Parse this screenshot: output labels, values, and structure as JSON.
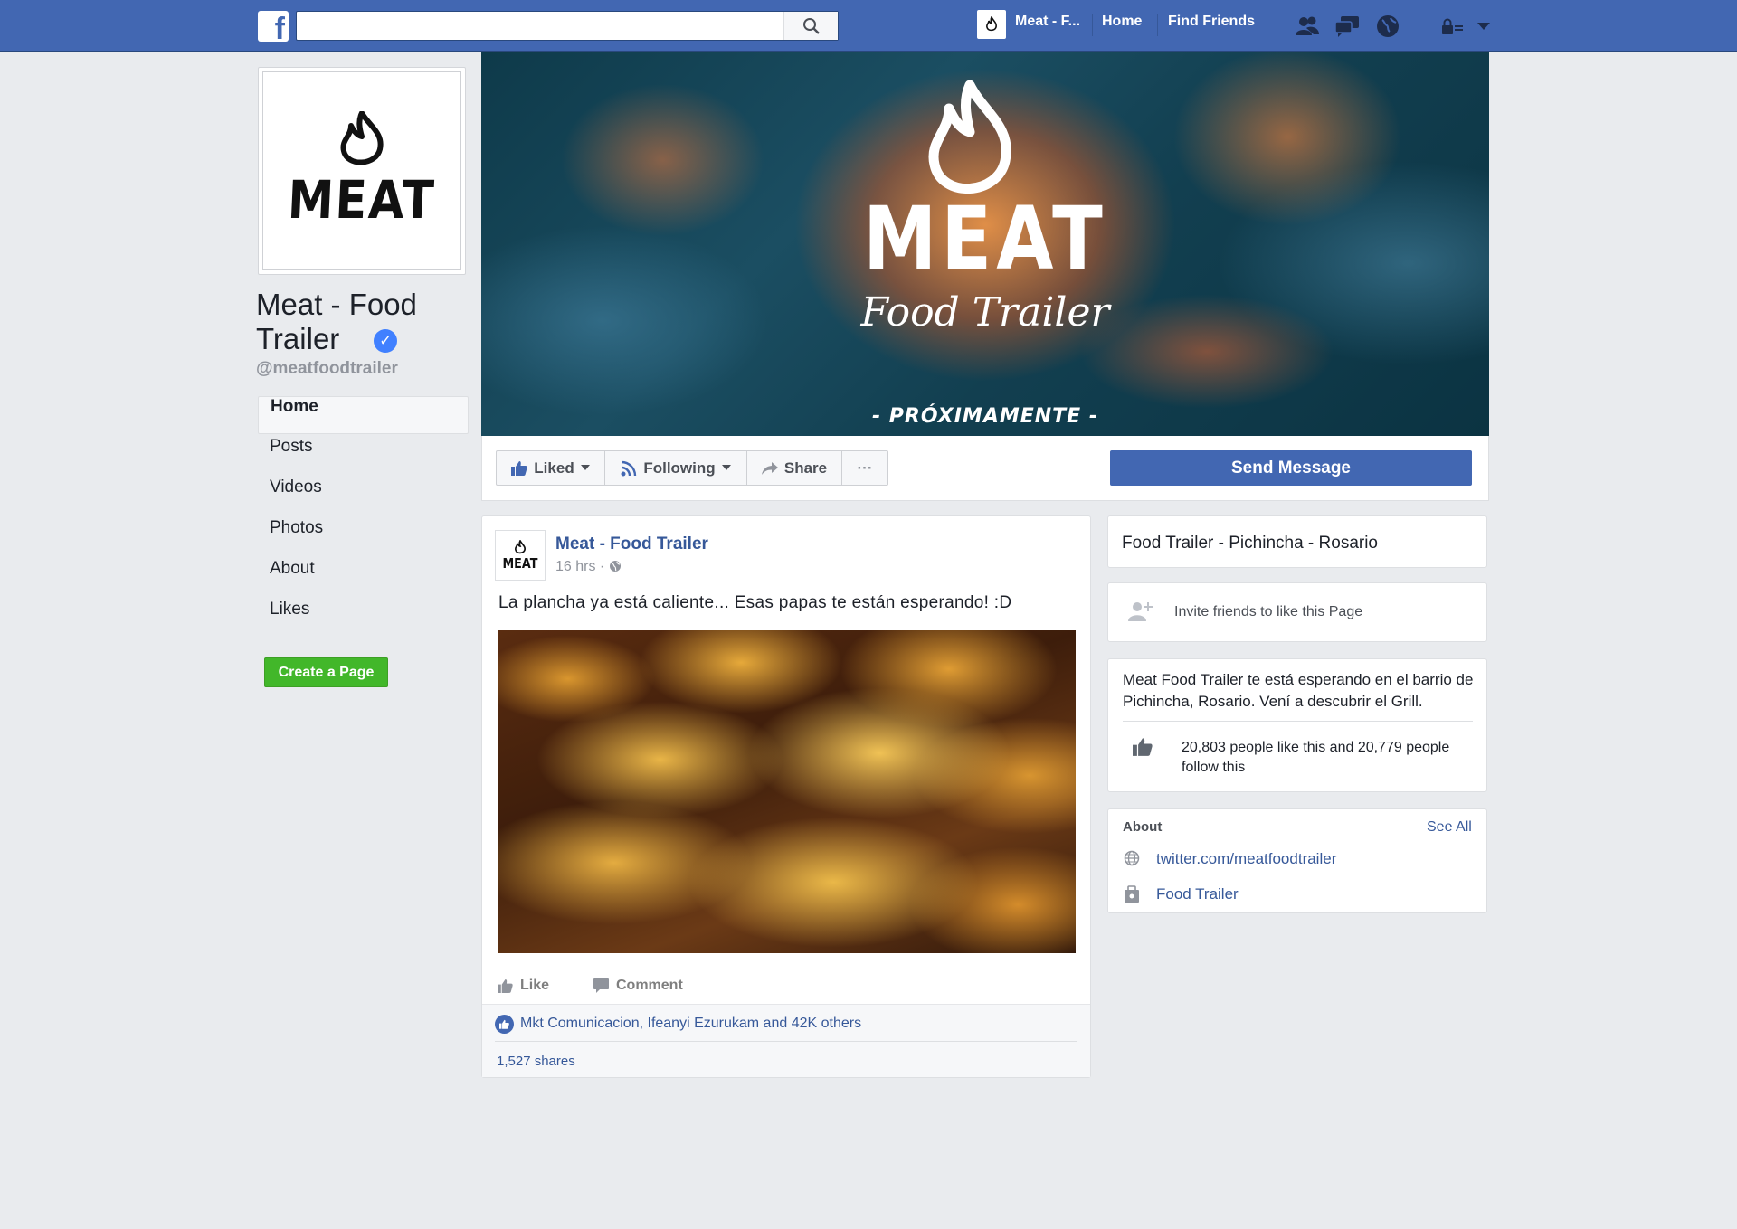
{
  "topbar": {
    "logo": "f",
    "search_placeholder": "",
    "page_shortcut": "Meat - F...",
    "home": "Home",
    "find_friends": "Find Friends"
  },
  "left": {
    "profile_logo_text": "MEAT",
    "page_name": "Meat - Food Trailer",
    "verified_mark": "✓",
    "handle": "@meatfoodtrailer",
    "nav": [
      "Home",
      "Posts",
      "Videos",
      "Photos",
      "About",
      "Likes"
    ],
    "create_page": "Create a Page"
  },
  "cover": {
    "title": "MEAT",
    "subtitle": "Food Trailer",
    "coming_soon": "- PRÓXIMAMENTE -"
  },
  "actions": {
    "liked": "Liked",
    "following": "Following",
    "share": "Share",
    "more": "···",
    "send_message": "Send Message"
  },
  "post": {
    "author": "Meat - Food Trailer",
    "time": "16 hrs · ",
    "text": "La plancha ya está caliente... Esas papas te están esperando!  :D",
    "like": "Like",
    "comment": "Comment",
    "likes_summary": "Mkt Comunicacion, Ifeanyi Ezurukam and 42K others",
    "shares": "1,527 shares"
  },
  "sidebar": {
    "category": "Food Trailer - Pichincha - Rosario",
    "invite": "Invite friends to like this Page",
    "description": "Meat Food Trailer te está esperando en el barrio de Pichincha, Rosario. Vení a descubrir el Grill.",
    "likes_stat": "20,803 people like this and 20,779 people follow this",
    "about_heading": "About",
    "see_all": "See All",
    "twitter": "twitter.com/meatfoodtrailer",
    "category_link": "Food Trailer"
  },
  "colors": {
    "brand_blue": "#4267b2",
    "link_blue": "#365899",
    "create_green": "#42b72a",
    "page_bg": "#e9ebee"
  }
}
